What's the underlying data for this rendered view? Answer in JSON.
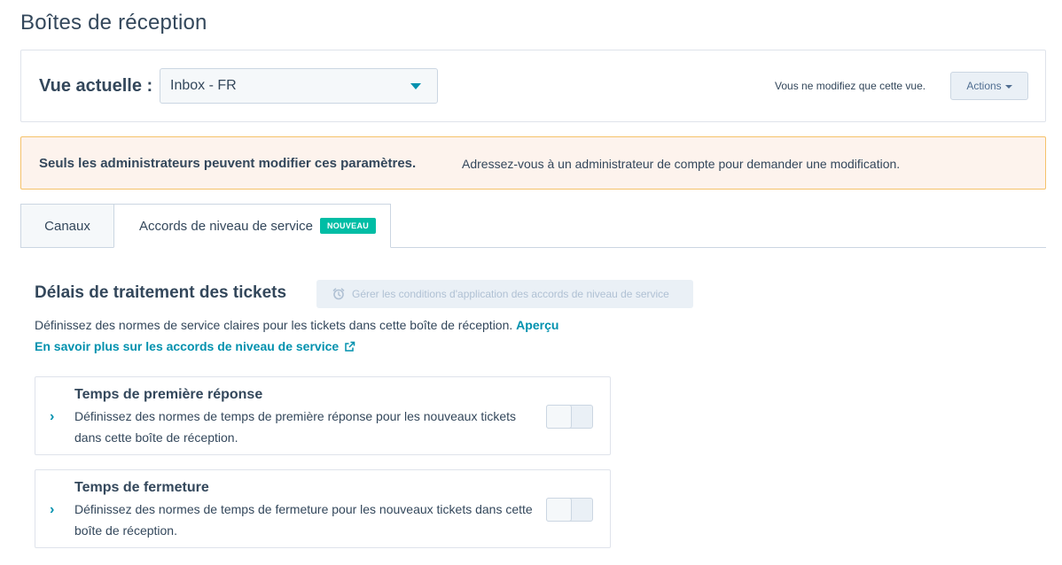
{
  "page": {
    "title": "Boîtes de réception"
  },
  "view": {
    "label": "Vue actuelle :",
    "selected": "Inbox - FR",
    "note": "Vous ne modifiez que cette vue.",
    "actions_label": "Actions"
  },
  "alert": {
    "title": "Seuls les administrateurs peuvent modifier ces paramètres.",
    "body": "Adressez-vous à un administrateur de compte pour demander une modification."
  },
  "tabs": [
    {
      "label": "Canaux",
      "active": false
    },
    {
      "label": "Accords de niveau de service",
      "active": true,
      "badge": "NOUVEAU"
    }
  ],
  "section": {
    "title": "Délais de traitement des tickets",
    "manage_button": "Gérer les conditions d'application des accords de niveau de service",
    "description": "Définissez des normes de service claires pour les tickets dans cette boîte de réception.",
    "preview_link": "Aperçu",
    "learn_more": "En savoir plus sur les accords de niveau de service"
  },
  "cards": [
    {
      "title": "Temps de première réponse",
      "description": "Définissez des normes de temps de première réponse pour les nouveaux tickets dans cette boîte de réception.",
      "enabled": false
    },
    {
      "title": "Temps de fermeture",
      "description": "Définissez des normes de temps de fermeture pour les nouveaux tickets dans cette boîte de réception.",
      "enabled": false
    }
  ],
  "colors": {
    "text": "#33475b",
    "link": "#0091ae",
    "badge": "#00bda5",
    "alert_bg": "#fdf3ed",
    "alert_border": "#f5c26b"
  }
}
